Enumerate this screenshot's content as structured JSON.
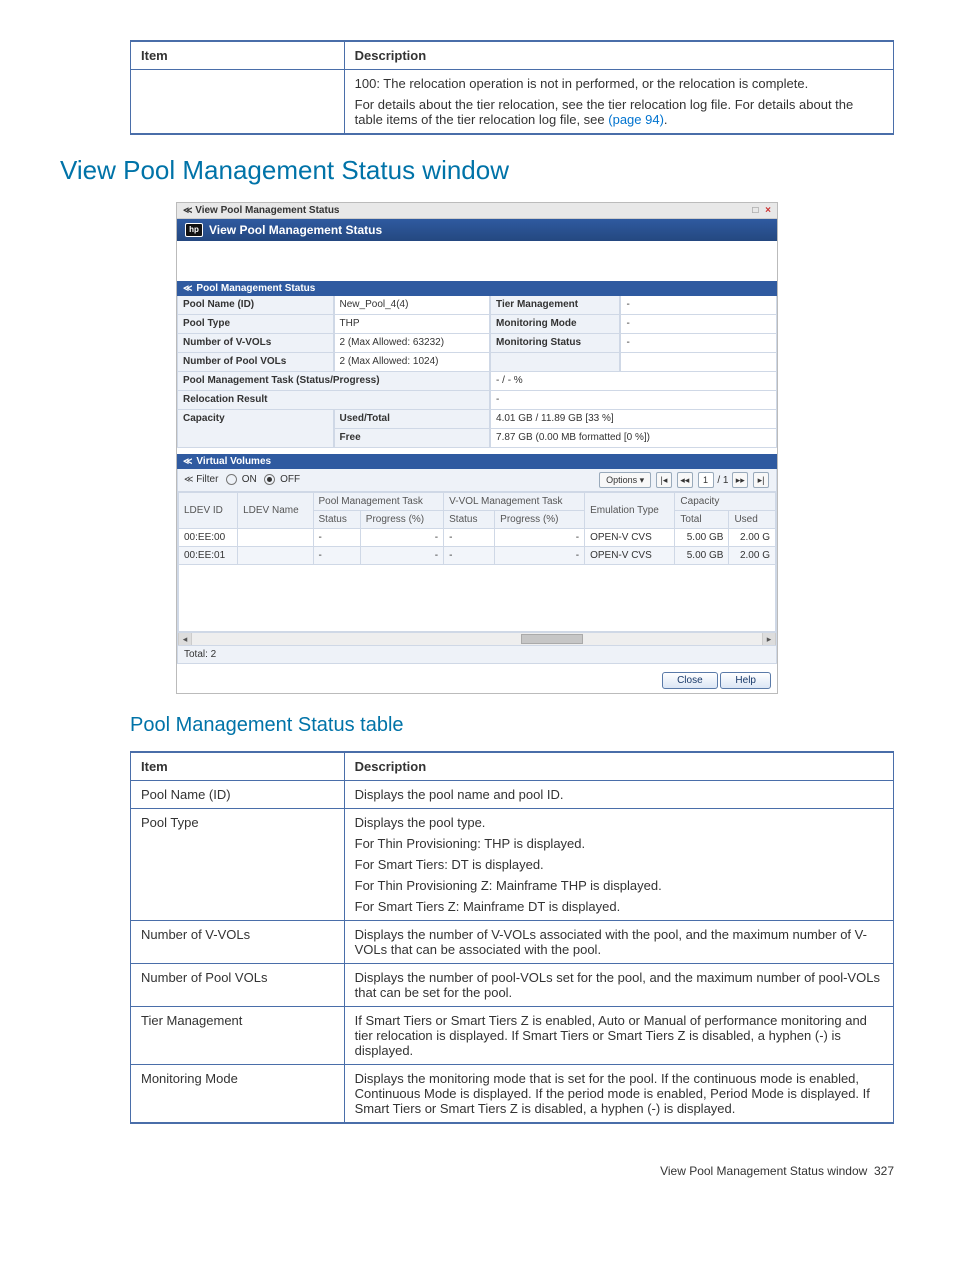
{
  "topTable": {
    "item_header": "Item",
    "desc_header": "Description",
    "desc_line1": "100: The relocation operation is not in performed, or the relocation is complete.",
    "desc_line2a": "For details about the tier relocation, see the tier relocation log file. For details about the table items of the tier relocation log file, see ",
    "desc_link": "(page 94)",
    "desc_line2b": "."
  },
  "h1": "View Pool Management Status window",
  "window": {
    "title": "View Pool Management Status",
    "banner": "View Pool Management Status",
    "close_icon": "×",
    "max_icon": "□",
    "chev": "≪",
    "pms_bar": "Pool Management Status",
    "grid": {
      "pool_name_lbl": "Pool Name (ID)",
      "pool_name_val": "New_Pool_4(4)",
      "tier_mgmt_lbl": "Tier Management",
      "tier_mgmt_val": "-",
      "pool_type_lbl": "Pool Type",
      "pool_type_val": "THP",
      "mon_mode_lbl": "Monitoring Mode",
      "mon_mode_val": "-",
      "num_vvols_lbl": "Number of V-VOLs",
      "num_vvols_val": "2 (Max Allowed: 63232)",
      "mon_status_lbl": "Monitoring Status",
      "mon_status_val": "-",
      "num_pvols_lbl": "Number of Pool VOLs",
      "num_pvols_val": "2 (Max Allowed: 1024)",
      "task_lbl": "Pool Management Task (Status/Progress)",
      "task_val": "- / - %",
      "reloc_lbl": "Relocation Result",
      "reloc_val": "-",
      "cap_lbl": "Capacity",
      "used_total_lbl": "Used/Total",
      "used_total_val": "4.01 GB / 11.89 GB [33 %]",
      "free_lbl": "Free",
      "free_val": "7.87 GB (0.00 MB formatted [0 %])"
    },
    "vv_bar": "Virtual Volumes",
    "filter": {
      "label": "Filter",
      "on": "ON",
      "off": "OFF",
      "options": "Options ▾",
      "page_cur": "1",
      "page_sep": "/ 1"
    },
    "vvtable": {
      "h_ldev_id": "LDEV ID",
      "h_ldev_name": "LDEV Name",
      "h_pmt": "Pool Management Task",
      "h_pmt_status": "Status",
      "h_pmt_prog": "Progress (%)",
      "h_vmt": "V-VOL Management Task",
      "h_vmt_status": "Status",
      "h_vmt_prog": "Progress (%)",
      "h_emul": "Emulation Type",
      "h_cap": "Capacity",
      "h_total": "Total",
      "h_used": "Used",
      "rows": [
        {
          "id": "00:EE:00",
          "name": "",
          "pmt_s": "-",
          "pmt_p": "-",
          "vmt_s": "-",
          "vmt_p": "-",
          "emul": "OPEN-V CVS",
          "total": "5.00 GB",
          "used": "2.00 G"
        },
        {
          "id": "00:EE:01",
          "name": "",
          "pmt_s": "-",
          "pmt_p": "-",
          "vmt_s": "-",
          "vmt_p": "-",
          "emul": "OPEN-V CVS",
          "total": "5.00 GB",
          "used": "2.00 G"
        }
      ]
    },
    "total_label": "Total: 2",
    "close_btn": "Close",
    "help_btn": "Help"
  },
  "h2": "Pool Management Status table",
  "pmsTable": {
    "item_header": "Item",
    "desc_header": "Description",
    "rows": [
      {
        "item": "Pool Name (ID)",
        "desc": [
          "Displays the pool name and pool ID."
        ]
      },
      {
        "item": "Pool Type",
        "desc": [
          "Displays the pool type.",
          "For Thin Provisioning: THP is displayed.",
          "For Smart Tiers: DT is displayed.",
          "For Thin Provisioning Z: Mainframe THP is displayed.",
          "For Smart Tiers Z: Mainframe DT is displayed."
        ]
      },
      {
        "item": "Number of V-VOLs",
        "desc": [
          "Displays the number of V-VOLs associated with the pool, and the maximum number of V-VOLs that can be associated with the pool."
        ]
      },
      {
        "item": "Number of Pool VOLs",
        "desc": [
          "Displays the number of pool-VOLs set for the pool, and the maximum number of pool-VOLs that can be set for the pool."
        ]
      },
      {
        "item": "Tier Management",
        "desc": [
          "If Smart Tiers or Smart Tiers Z is enabled, Auto or Manual of performance monitoring and tier relocation is displayed. If Smart Tiers or Smart Tiers Z is disabled, a hyphen (-) is displayed."
        ]
      },
      {
        "item": "Monitoring Mode",
        "desc": [
          "Displays the monitoring mode that is set for the pool. If the continuous mode is enabled, Continuous Mode is displayed. If the period mode is enabled, Period Mode is displayed. If Smart Tiers or Smart Tiers Z is disabled, a hyphen (-) is displayed."
        ]
      }
    ]
  },
  "footer": {
    "text": "View Pool Management Status window",
    "page": "327"
  }
}
